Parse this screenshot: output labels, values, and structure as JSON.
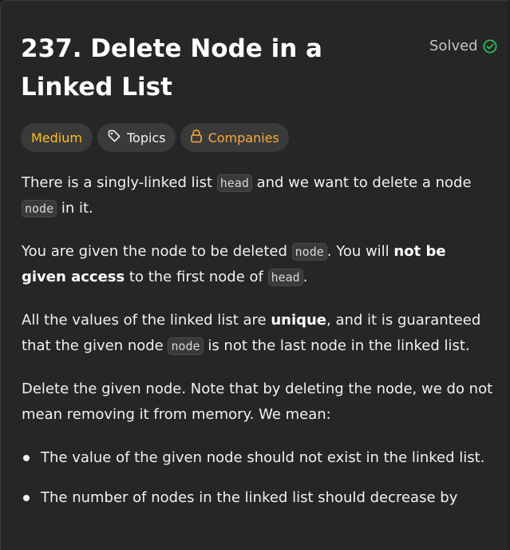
{
  "problem": {
    "title": "237. Delete Node in a Linked List",
    "status_label": "Solved",
    "status_icon": "check-circle-icon",
    "status_color": "#2cbb5d"
  },
  "tags": {
    "difficulty": "Medium",
    "difficulty_color": "#ffc01e",
    "topics_label": "Topics",
    "topics_icon": "tag-icon",
    "companies_label": "Companies",
    "companies_icon": "lock-icon",
    "companies_color": "#f7a93a"
  },
  "description": {
    "p1": {
      "t1": "There is a singly-linked list ",
      "c1": "head",
      "t2": " and we want to delete a node ",
      "c2": "node",
      "t3": " in it."
    },
    "p2": {
      "t1": "You are given the node to be deleted ",
      "c1": "node",
      "t2": ". You will ",
      "b1": "not be given access",
      "t3": " to the first node of ",
      "c2": "head",
      "t4": "."
    },
    "p3": {
      "t1": "All the values of the linked list are ",
      "b1": "unique",
      "t2": ", and it is guaranteed that the given node ",
      "c1": "node",
      "t3": " is not the last node in the linked list."
    },
    "p4": "Delete the given node. Note that by deleting the node, we do not mean removing it from memory. We mean:",
    "bullets": [
      "The value of the given node should not exist in the linked list.",
      "The number of nodes in the linked list should decrease by"
    ]
  }
}
